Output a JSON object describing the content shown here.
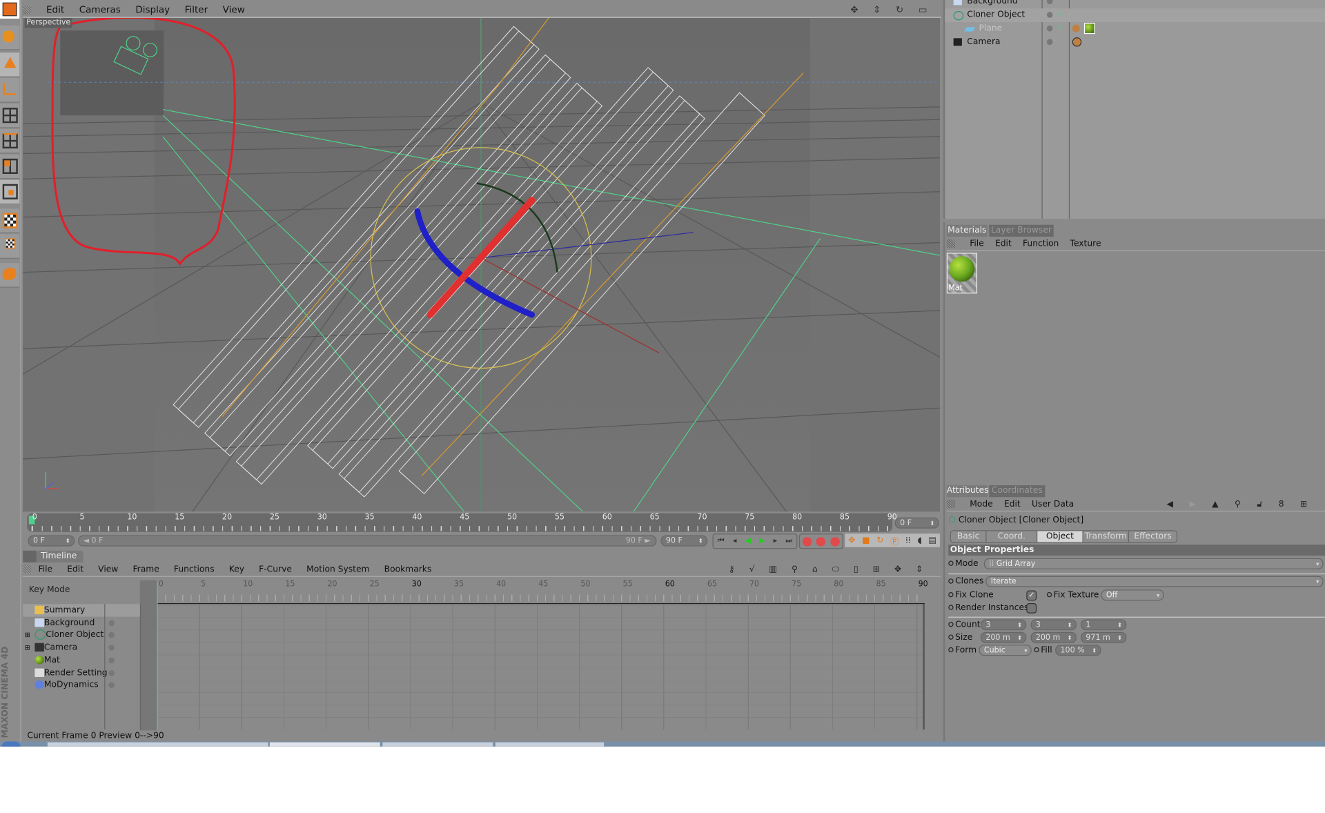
{
  "viewport": {
    "menu": [
      "Edit",
      "Cameras",
      "Display",
      "Filter",
      "View"
    ],
    "label": "Perspective",
    "nav_icons": [
      "move-view-icon",
      "zoom-view-icon",
      "rotate-view-icon",
      "maximize-view-icon"
    ]
  },
  "left_toolbar": {
    "icons": [
      "layout-icon",
      "model-tool-icon",
      "object-axis-icon",
      "axis-icon",
      "points-mode-icon",
      "edges-mode-icon",
      "polygons-mode-icon",
      "uvw-mode-icon",
      "texture-mode-icon",
      "texture-axis-icon",
      "primitives-icon"
    ]
  },
  "ruler": {
    "ticks": [
      "0",
      "5",
      "10",
      "15",
      "20",
      "25",
      "30",
      "35",
      "40",
      "45",
      "50",
      "55",
      "60",
      "65",
      "70",
      "75",
      "80",
      "85",
      "90"
    ],
    "current_frame": "0 F"
  },
  "transport": {
    "start_field": "0 F",
    "slider_start": "◄ 0 F",
    "slider_end": "90 F ►",
    "end_field": "90 F",
    "buttons": [
      "go-start",
      "prev-key",
      "play-backward",
      "play-forward",
      "next-key",
      "go-end"
    ],
    "record": [
      "record-key",
      "auto-key",
      "keyframe-selection"
    ],
    "tools": [
      "move-keys",
      "scale-keys",
      "rotate-keys",
      "param-keys",
      "pla-keys",
      "sound",
      "scheme"
    ]
  },
  "timeline": {
    "tab": "Timeline",
    "menu": [
      "File",
      "Edit",
      "View",
      "Frame",
      "Functions",
      "Key",
      "F-Curve",
      "Motion System",
      "Bookmarks"
    ],
    "mode": "Key Mode",
    "ticks": [
      "0",
      "5",
      "10",
      "15",
      "20",
      "25",
      "30",
      "35",
      "40",
      "45",
      "50",
      "55",
      "60",
      "65",
      "70",
      "75",
      "80",
      "85",
      "90"
    ],
    "tracks": [
      {
        "name": "Summary",
        "icon": "folder-icon"
      },
      {
        "name": "Background",
        "icon": "background-icon"
      },
      {
        "name": "Cloner Object",
        "icon": "cloner-icon",
        "expandable": true
      },
      {
        "name": "Camera",
        "icon": "camera-icon",
        "expandable": true
      },
      {
        "name": "Mat",
        "icon": "material-icon"
      },
      {
        "name": "Render Setting",
        "icon": "render-setting-icon"
      },
      {
        "name": "MoDynamics",
        "icon": "modynamics-icon"
      }
    ],
    "status": "Current Frame  0  Preview  0-->90",
    "logo": "MAXON CINEMA 4D"
  },
  "objects": {
    "items": [
      {
        "name": "Background",
        "dim": false
      },
      {
        "name": "Cloner Object",
        "dim": false
      },
      {
        "name": "Plane",
        "dim": true
      },
      {
        "name": "Camera",
        "dim": false
      }
    ]
  },
  "materials": {
    "tabs": [
      "Materials",
      "Layer Browser"
    ],
    "menu": [
      "File",
      "Edit",
      "Function",
      "Texture"
    ],
    "items": [
      {
        "name": "Mat",
        "color": "#6aa81e"
      }
    ]
  },
  "attributes": {
    "tabs": [
      "Attributes",
      "Coordinates"
    ],
    "menu": [
      "Mode",
      "Edit",
      "User Data"
    ],
    "title": "Cloner Object [Cloner Object]",
    "object_tabs": [
      "Basic",
      "Coord.",
      "Object",
      "Transform",
      "Effectors"
    ],
    "active_tab": "Object",
    "section": "Object Properties",
    "mode_label": "Mode",
    "mode_value": "Grid Array",
    "clones_label": "Clones",
    "clones_value": "Iterate",
    "fix_clone_label": "Fix Clone",
    "fix_clone_checked": true,
    "fix_texture_label": "Fix Texture",
    "fix_texture_value": "Off",
    "render_instances_label": "Render Instances",
    "render_instances_checked": false,
    "count_label": "Count",
    "count": [
      "3",
      "3",
      "1"
    ],
    "size_label": "Size",
    "size": [
      "200 m",
      "200 m",
      "971 m"
    ],
    "form_label": "Form",
    "form_value": "Cubic",
    "fill_label": "Fill",
    "fill_value": "100 %"
  },
  "colors": {
    "accent_green": "#4fd08a",
    "annotation_red": "#e0202a",
    "panel": "#8a8a8a",
    "viewport": "#6e6e6e"
  }
}
